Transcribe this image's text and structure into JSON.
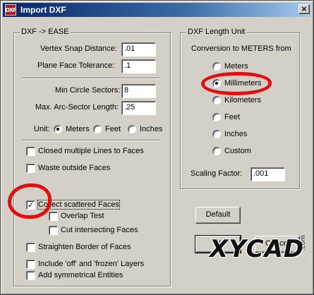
{
  "window": {
    "title": "Import DXF",
    "icon_label": "DXF",
    "close_glyph": "×"
  },
  "left_group": {
    "title": "DXF -> EASE",
    "vertex_snap_label": "Vertex Snap Distance:",
    "vertex_snap_value": ".01",
    "plane_face_label": "Plane Face Tolerance:",
    "plane_face_value": ".1",
    "min_circle_label": "Min Circle Sectors:",
    "min_circle_value": "8",
    "max_arc_label": "Max. Arc-Sector Length:",
    "max_arc_value": ".25",
    "unit_label": "Unit:",
    "unit_options": [
      "Meters",
      "Feet",
      "Inches"
    ],
    "unit_selected": "Meters",
    "checkboxes": [
      {
        "label": "Closed multiple Lines to Faces",
        "checked": false
      },
      {
        "label": "Waste outside Faces",
        "checked": false
      },
      {
        "label": "Collect scattered Faces",
        "checked": true
      },
      {
        "label": "Overlap Test",
        "checked": false
      },
      {
        "label": "Cut intersecting Faces",
        "checked": false
      },
      {
        "label": "Straighten Border of Faces",
        "checked": false
      },
      {
        "label": "Include 'off' and 'frozen' Layers",
        "checked": false
      },
      {
        "label": "Add  symmetrical Entities",
        "checked": false
      }
    ],
    "check_glyph": "✓"
  },
  "right_group": {
    "title": "DXF Length Unit",
    "conversion_label": "Conversion to METERS from",
    "options": [
      "Meters",
      "Millimeters",
      "Kilometers",
      "Feet",
      "Inches",
      "Custom"
    ],
    "selected": "Millimeters",
    "scaling_label": "Scaling Factor:",
    "scaling_value": ".001"
  },
  "buttons": {
    "default_label": "Default",
    "ok_label": "Ok",
    "cancel_label": "Cancel"
  },
  "watermark": {
    "text": "XYCAD",
    "suffix": ".com"
  },
  "colors": {
    "title_bar": "#0a246a",
    "dialog_face": "#d4d0c8",
    "annotation_circle": "#e01010"
  }
}
